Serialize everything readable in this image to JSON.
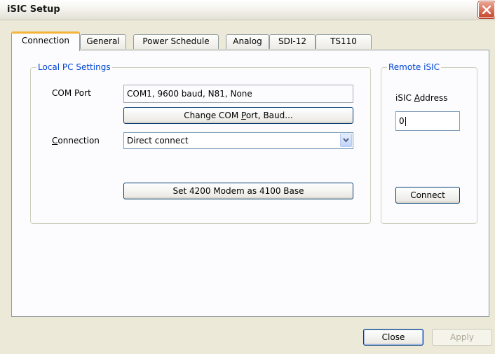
{
  "window": {
    "title": "iSIC Setup"
  },
  "tabs": [
    {
      "label": "Connection"
    },
    {
      "label": "General"
    },
    {
      "label": "Power Schedule"
    },
    {
      "label": "Analog"
    },
    {
      "label": "SDI-12"
    },
    {
      "label": "TS110"
    }
  ],
  "local": {
    "legend": "Local PC Settings",
    "com_port_label": "COM Port",
    "com_port_value": "COM1, 9600 baud, N81, None",
    "change_com_button": {
      "before": "Change COM ",
      "mnemonic": "P",
      "after": "ort, Baud..."
    },
    "connection_label": {
      "mnemonic": "C",
      "after": "onnection"
    },
    "connection_selected": "Direct connect",
    "set_modem_button": "Set 4200 Modem as 4100 Base"
  },
  "remote": {
    "legend": "Remote iSIC",
    "address_label": {
      "before": "iSIC ",
      "mnemonic": "A",
      "after": "ddress"
    },
    "address_value": "0",
    "connect_button": "Connect"
  },
  "footer": {
    "close_button": "Close",
    "apply_button": "Apply"
  }
}
